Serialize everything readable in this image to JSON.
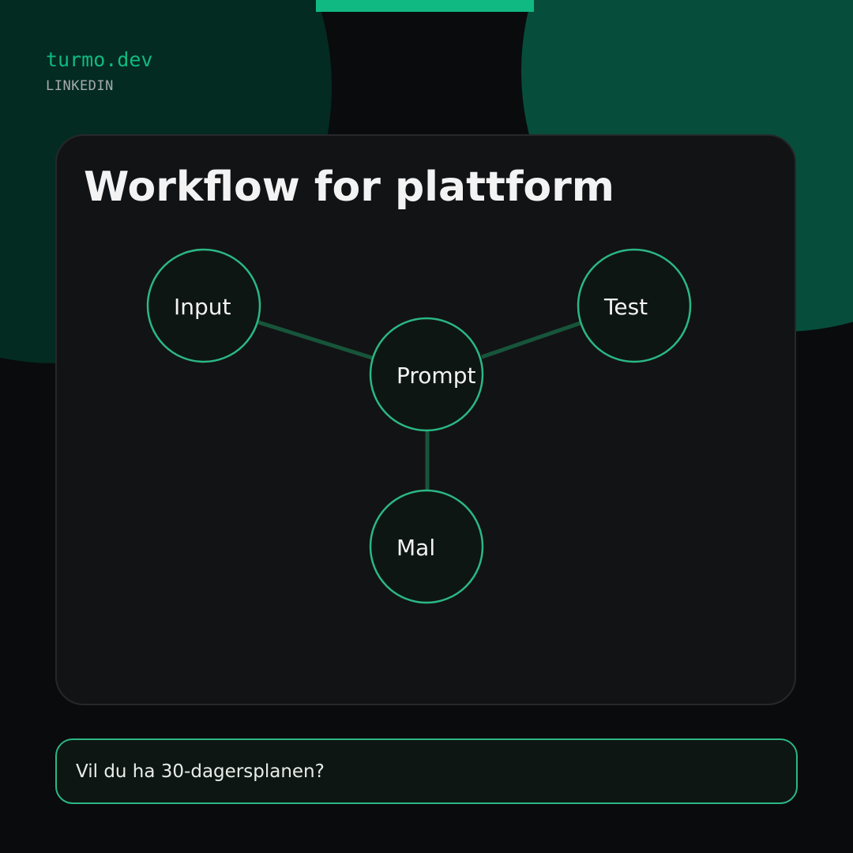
{
  "brand": {
    "name": "turmo.dev",
    "channel": "LINKEDIN"
  },
  "card": {
    "title": "Workflow for plattform"
  },
  "diagram": {
    "nodes": [
      {
        "id": "input",
        "label": "Input"
      },
      {
        "id": "prompt",
        "label": "Prompt"
      },
      {
        "id": "test",
        "label": "Test"
      },
      {
        "id": "mal",
        "label": "Mal"
      }
    ],
    "edges": [
      {
        "from": "input",
        "to": "prompt"
      },
      {
        "from": "test",
        "to": "prompt"
      },
      {
        "from": "prompt",
        "to": "mal"
      }
    ]
  },
  "cta": {
    "label": "Vil du ha 30-dagersplanen?"
  },
  "colors": {
    "background": "#0a0b0d",
    "accent": "#10b981",
    "node_stroke": "#2bb784",
    "edge": "#17553a",
    "card": "#121315"
  }
}
